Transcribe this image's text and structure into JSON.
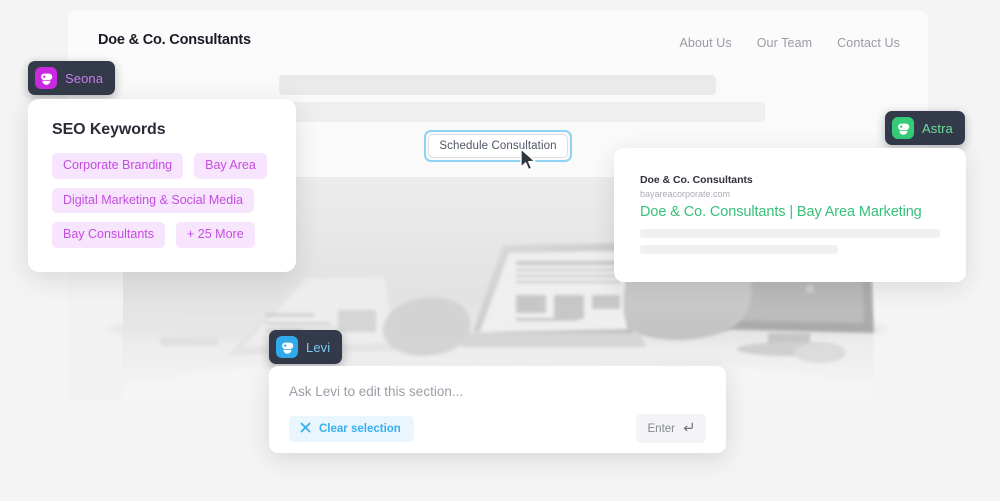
{
  "site": {
    "logo": "Doe & Co. Consultants",
    "nav": [
      {
        "label": "About Us"
      },
      {
        "label": "Our Team"
      },
      {
        "label": "Contact Us"
      }
    ],
    "cta_label": "Schedule Consultation",
    "hero_image": "office-desk-laptop-hands-grayscale-photo"
  },
  "agents": {
    "seona": {
      "label": "Seona",
      "icon": "seona-agent-icon",
      "color": "#c82ae0"
    },
    "astra": {
      "label": "Astra",
      "icon": "astra-agent-icon",
      "color": "#35cb77"
    },
    "levi": {
      "label": "Levi",
      "icon": "levi-agent-icon",
      "color": "#2fabec"
    }
  },
  "seo_card": {
    "title": "SEO Keywords",
    "chips": [
      {
        "label": "Corporate Branding"
      },
      {
        "label": "Bay Area"
      },
      {
        "label": "Digital Marketing & Social Media"
      },
      {
        "label": "Bay Consultants"
      },
      {
        "label": "+ 25 More"
      }
    ],
    "chip_bg": "#f7e4fd",
    "chip_text": "#c44ce0"
  },
  "serp_card": {
    "site_name": "Doe & Co. Consultants",
    "url": "bayareacorporate.com",
    "title": "Doe & Co. Consultants | Bay Area Marketing",
    "title_color": "#37c07a"
  },
  "prompt_card": {
    "placeholder": "Ask Levi to edit this section...",
    "value": "",
    "clear_label": "Clear selection",
    "clear_icon": "close-x-icon",
    "enter_label": "Enter",
    "enter_icon": "enter-return-icon",
    "accent": "#38b0ef"
  },
  "cursor": {
    "icon": "mouse-pointer-cursor"
  }
}
